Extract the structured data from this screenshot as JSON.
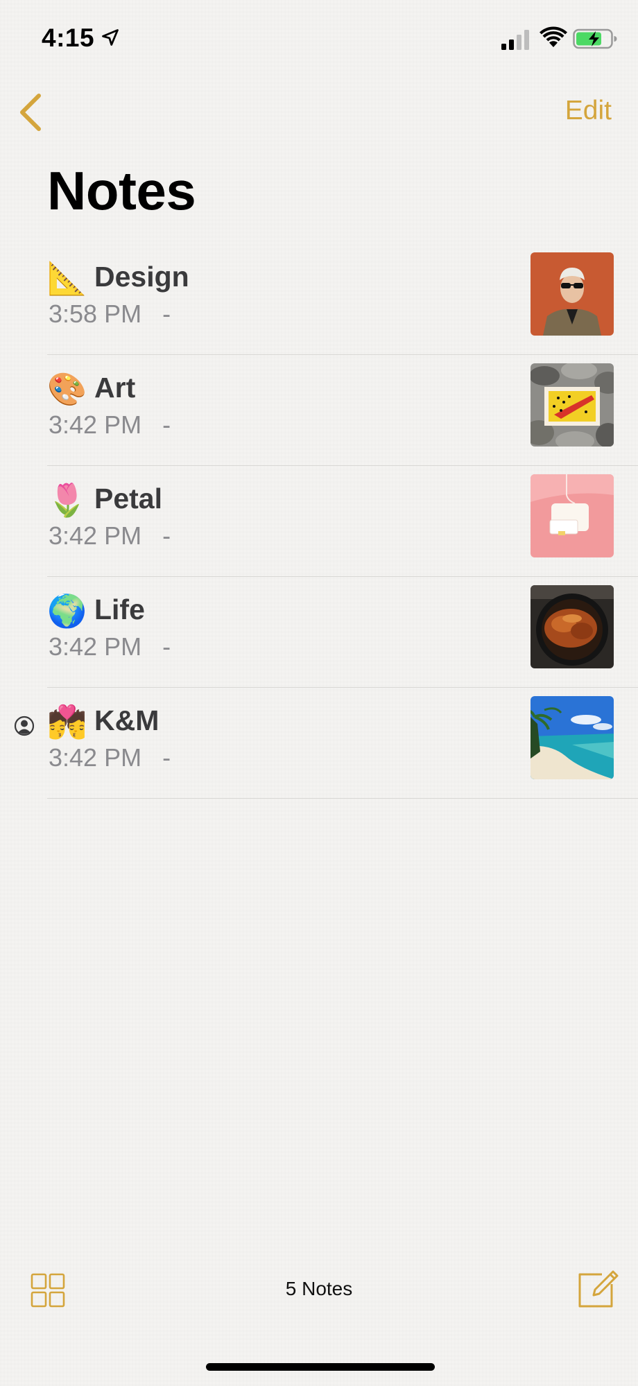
{
  "status_bar": {
    "time": "4:15"
  },
  "nav": {
    "edit_label": "Edit",
    "title": "Notes"
  },
  "notes": [
    {
      "emoji": "📐",
      "title": "Design",
      "time": "3:58 PM",
      "separator": "-",
      "thumbnail": "portrait-orange-wall",
      "shared": false
    },
    {
      "emoji": "🎨",
      "title": "Art",
      "time": "3:42 PM",
      "separator": "-",
      "thumbnail": "painting-on-rocks",
      "shared": false
    },
    {
      "emoji": "🌷",
      "title": "Petal",
      "time": "3:42 PM",
      "separator": "-",
      "thumbnail": "pink-device",
      "shared": false
    },
    {
      "emoji": "🌍",
      "title": "Life",
      "time": "3:42 PM",
      "separator": "-",
      "thumbnail": "roast-chicken",
      "shared": false
    },
    {
      "emoji": "💏",
      "title": "K&M",
      "time": "3:42 PM",
      "separator": "-",
      "thumbnail": "tropical-beach",
      "shared": true
    }
  ],
  "toolbar": {
    "count_label": "5 Notes"
  },
  "colors": {
    "accent": "#d4a53c",
    "background": "#f4f3f1",
    "secondary_text": "#8a8a8e"
  }
}
